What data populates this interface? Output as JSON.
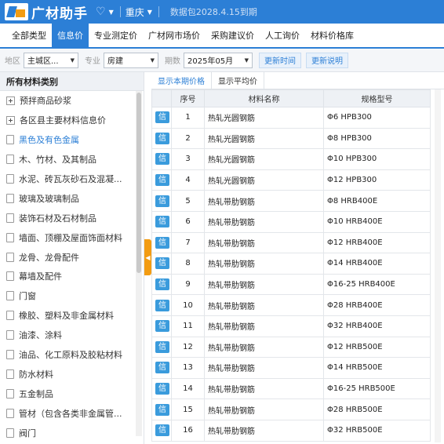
{
  "titlebar": {
    "app_name": "广材助手",
    "city": "重庆",
    "expire": "数据包2028.4.15到期"
  },
  "tabs": [
    "全部类型",
    "信息价",
    "专业测定价",
    "广材网市场价",
    "采购建议价",
    "人工询价",
    "材料价格库"
  ],
  "filters": {
    "region_label": "地区",
    "region_value": "主城区...",
    "profession_label": "专业",
    "profession_value": "房建",
    "period_label": "期数",
    "period_value": "2025年05月",
    "update_time": "更新时间",
    "update_note": "更新说明"
  },
  "sidebar": {
    "header": "所有材料类别",
    "items": [
      {
        "label": "预拌商品砂浆",
        "icon": "plus"
      },
      {
        "label": "各区县主要材料信息价",
        "icon": "plus"
      },
      {
        "label": "黑色及有色金属",
        "icon": "doc"
      },
      {
        "label": "木、竹材、及其制品",
        "icon": "doc"
      },
      {
        "label": "水泥、砖瓦灰砂石及混凝...",
        "icon": "doc"
      },
      {
        "label": "玻璃及玻璃制品",
        "icon": "doc"
      },
      {
        "label": "装饰石材及石材制品",
        "icon": "doc"
      },
      {
        "label": "墙面、顶棚及屋面饰面材料",
        "icon": "doc"
      },
      {
        "label": "龙骨、龙骨配件",
        "icon": "doc"
      },
      {
        "label": "幕墙及配件",
        "icon": "doc"
      },
      {
        "label": "门窗",
        "icon": "doc"
      },
      {
        "label": "橡胶、塑料及非金属材料",
        "icon": "doc"
      },
      {
        "label": "油漆、涂料",
        "icon": "doc"
      },
      {
        "label": "油品、化工原料及胶粘材料",
        "icon": "doc"
      },
      {
        "label": "防水材料",
        "icon": "doc"
      },
      {
        "label": "五金制品",
        "icon": "doc"
      },
      {
        "label": "管材（包含各类非金属管...",
        "icon": "doc"
      },
      {
        "label": "阀门",
        "icon": "doc"
      }
    ]
  },
  "subtabs": [
    "显示本期价格",
    "显示平均价"
  ],
  "table": {
    "headers": [
      "序号",
      "材料名称",
      "规格型号"
    ],
    "badge": "信",
    "rows": [
      {
        "no": "1",
        "name": "热轧光圆钢筋",
        "spec": "Φ6 HPB300"
      },
      {
        "no": "2",
        "name": "热轧光圆钢筋",
        "spec": "Φ8 HPB300"
      },
      {
        "no": "3",
        "name": "热轧光圆钢筋",
        "spec": "Φ10 HPB300"
      },
      {
        "no": "4",
        "name": "热轧光圆钢筋",
        "spec": "Φ12 HPB300"
      },
      {
        "no": "5",
        "name": "热轧带肋钢筋",
        "spec": "Φ8 HRB400E"
      },
      {
        "no": "6",
        "name": "热轧带肋钢筋",
        "spec": "Φ10 HRB400E"
      },
      {
        "no": "7",
        "name": "热轧带肋钢筋",
        "spec": "Φ12 HRB400E"
      },
      {
        "no": "8",
        "name": "热轧带肋钢筋",
        "spec": "Φ14 HRB400E"
      },
      {
        "no": "9",
        "name": "热轧带肋钢筋",
        "spec": "Φ16-25 HRB400E"
      },
      {
        "no": "10",
        "name": "热轧带肋钢筋",
        "spec": "Φ28 HRB400E"
      },
      {
        "no": "11",
        "name": "热轧带肋钢筋",
        "spec": "Φ32 HRB400E"
      },
      {
        "no": "12",
        "name": "热轧带肋钢筋",
        "spec": "Φ12 HRB500E"
      },
      {
        "no": "13",
        "name": "热轧带肋钢筋",
        "spec": "Φ14 HRB500E"
      },
      {
        "no": "14",
        "name": "热轧带肋钢筋",
        "spec": "Φ16-25 HRB500E"
      },
      {
        "no": "15",
        "name": "热轧带肋钢筋",
        "spec": "Φ28 HRB500E"
      },
      {
        "no": "16",
        "name": "热轧带肋钢筋",
        "spec": "Φ32 HRB500E"
      }
    ]
  },
  "colors": {
    "primary": "#2c7fd6",
    "accent": "#f39c12",
    "badge": "#3a9bdc"
  }
}
